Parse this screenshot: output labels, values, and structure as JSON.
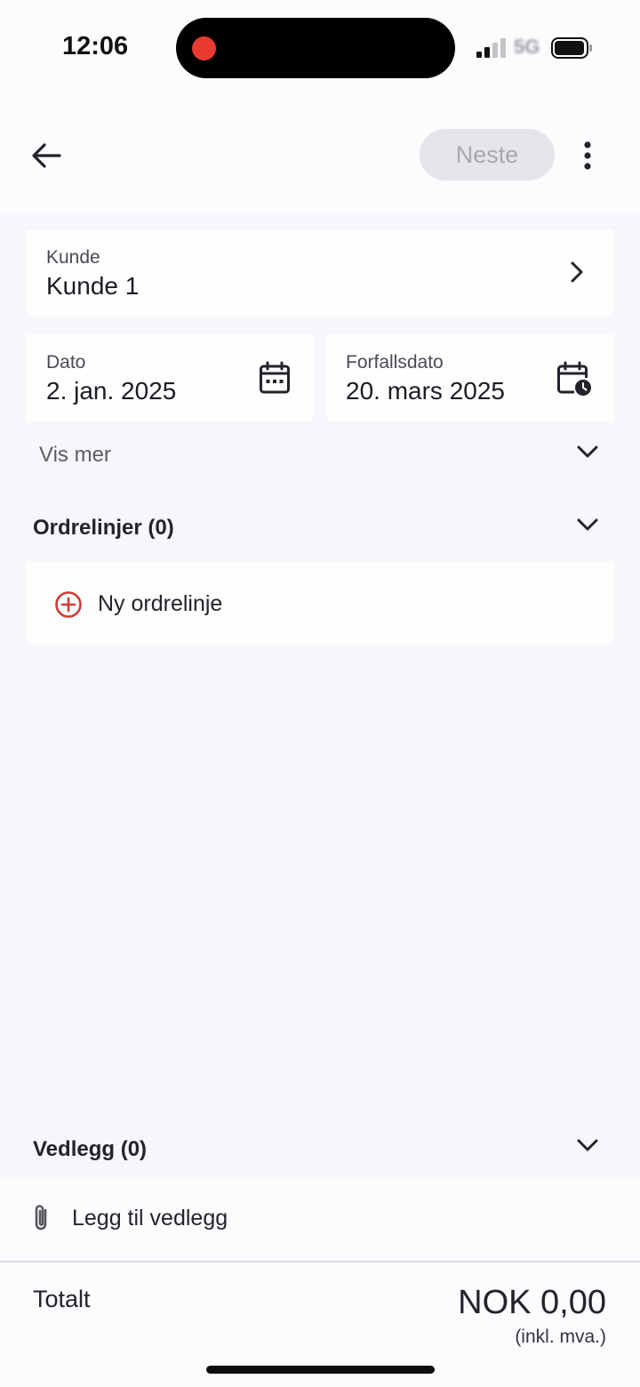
{
  "status": {
    "time": "12:06",
    "network": "5G"
  },
  "toolbar": {
    "next_label": "Neste"
  },
  "customer": {
    "label": "Kunde",
    "value": "Kunde 1"
  },
  "date": {
    "label": "Dato",
    "value": "2. jan. 2025"
  },
  "due_date": {
    "label": "Forfallsdato",
    "value": "20. mars 2025"
  },
  "more": {
    "label": "Vis mer"
  },
  "order_lines": {
    "title": "Ordrelinjer (0)",
    "add_label": "Ny ordrelinje"
  },
  "attachments": {
    "title": "Vedlegg (0)",
    "add_label": "Legg til vedlegg"
  },
  "total": {
    "label": "Totalt",
    "value": "NOK 0,00",
    "note": "(inkl. mva.)"
  },
  "colors": {
    "accent": "#d23a35",
    "background": "#f6f6fb",
    "card": "#fefeff",
    "disabled_button": "#e5e5ea"
  },
  "icons": [
    "back-arrow-icon",
    "more-vertical-icon",
    "chevron-right-icon",
    "calendar-icon",
    "calendar-clock-icon",
    "chevron-down-icon",
    "plus-circle-icon",
    "paperclip-icon"
  ]
}
